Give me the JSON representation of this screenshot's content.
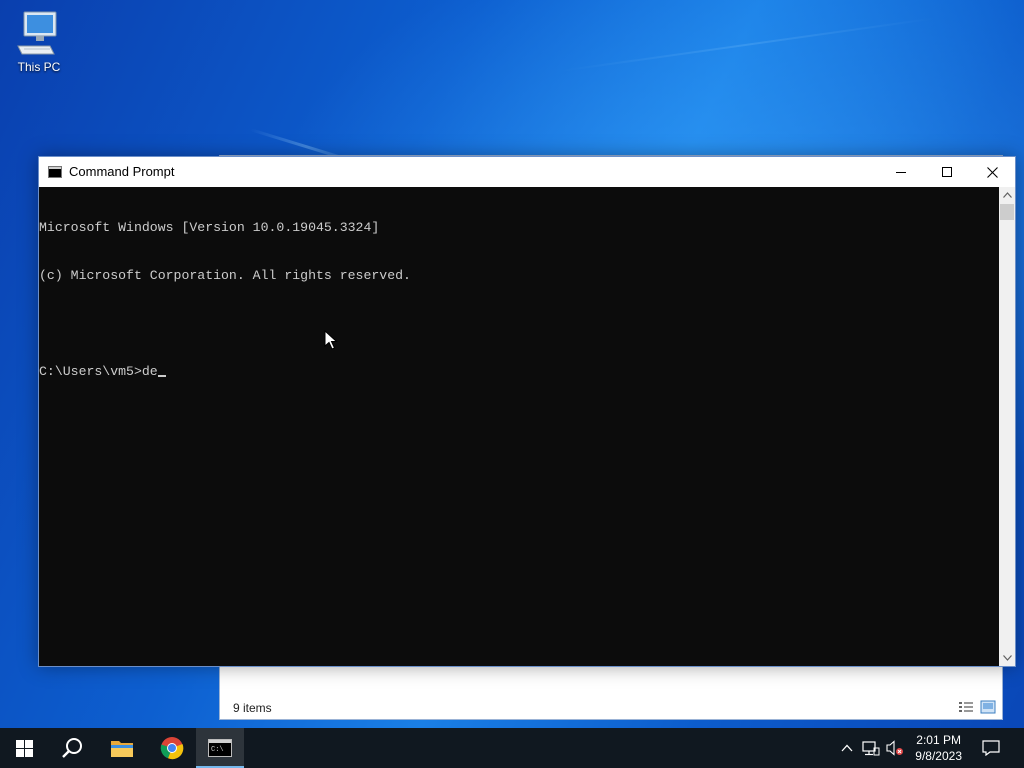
{
  "desktop": {
    "icons": [
      {
        "label": "This PC",
        "icon": "this-pc-icon"
      }
    ]
  },
  "explorer": {
    "status_count": "9 items"
  },
  "cmd": {
    "title": "Command Prompt",
    "lines": [
      "Microsoft Windows [Version 10.0.19045.3324]",
      "(c) Microsoft Corporation. All rights reserved.",
      "",
      "C:\\Users\\vm5>de"
    ]
  },
  "taskbar": {
    "apps": [
      {
        "name": "start",
        "icon": "windows-logo-icon"
      },
      {
        "name": "search",
        "icon": "search-icon"
      },
      {
        "name": "file-explorer",
        "icon": "folder-icon"
      },
      {
        "name": "chrome",
        "icon": "chrome-icon"
      },
      {
        "name": "command-prompt",
        "icon": "cmd-icon",
        "active": true
      }
    ],
    "clock": {
      "time": "2:01 PM",
      "date": "9/8/2023"
    }
  },
  "colors": {
    "console_bg": "#0c0c0c",
    "console_text": "#cccccc",
    "taskbar_bg": "#101820",
    "accent": "#76b9ed"
  }
}
